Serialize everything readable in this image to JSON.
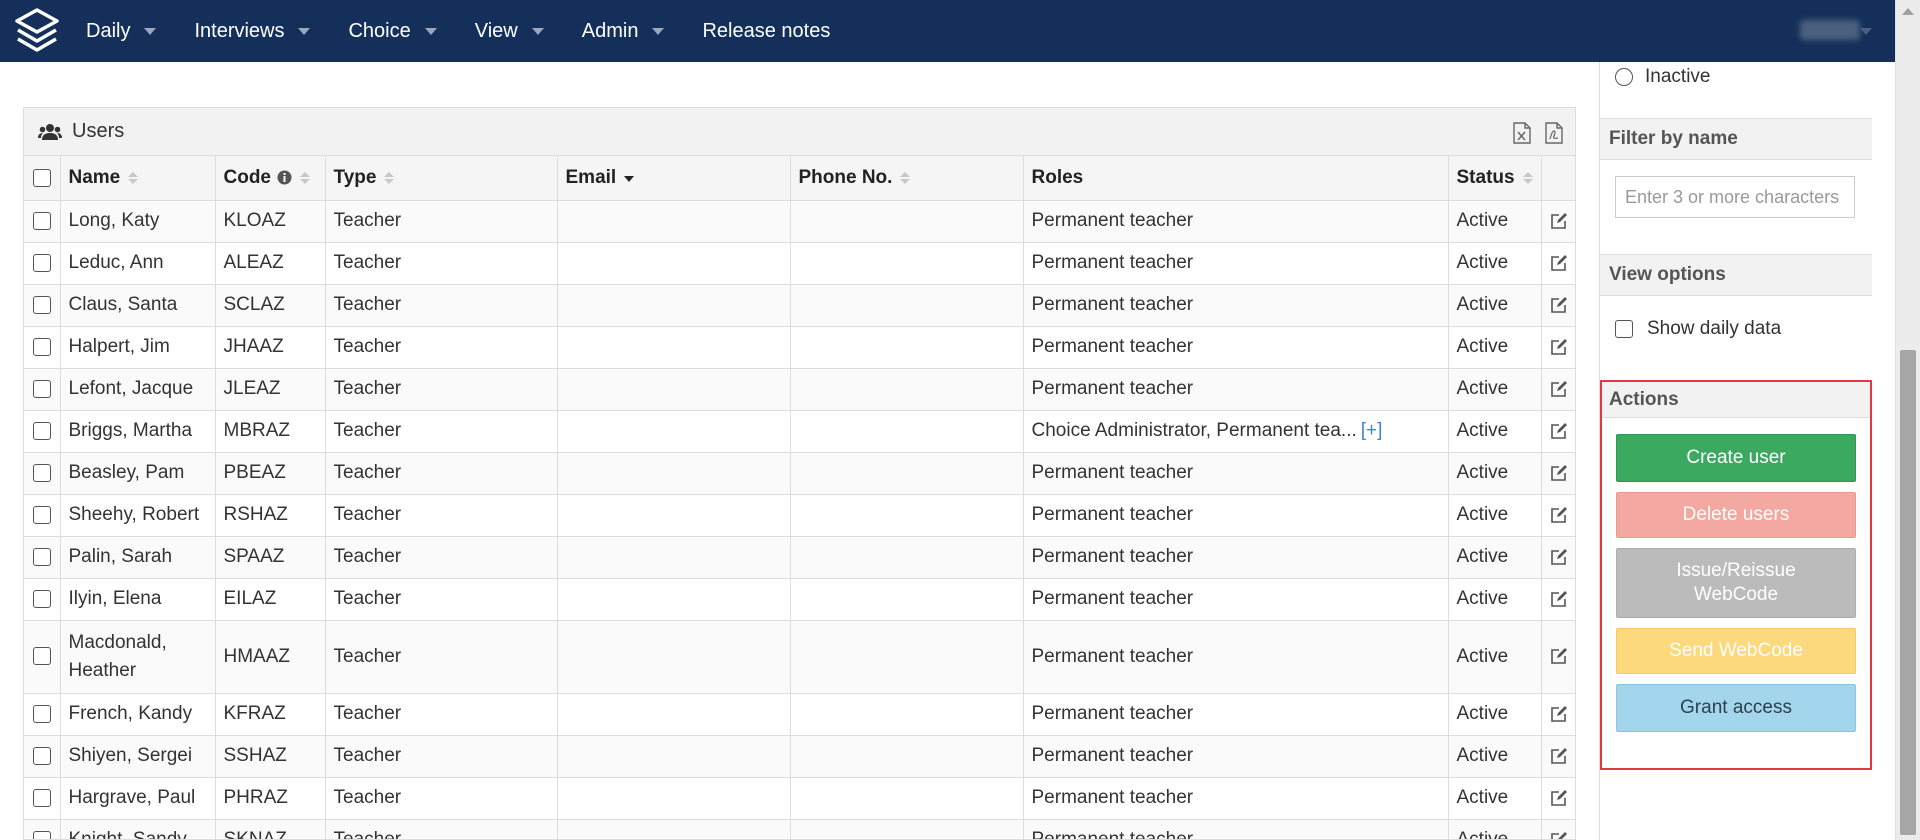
{
  "nav": {
    "items": [
      {
        "label": "Daily",
        "dropdown": true
      },
      {
        "label": "Interviews",
        "dropdown": true
      },
      {
        "label": "Choice",
        "dropdown": true
      },
      {
        "label": "View",
        "dropdown": true
      },
      {
        "label": "Admin",
        "dropdown": true
      },
      {
        "label": "Release notes",
        "dropdown": false
      }
    ]
  },
  "panel": {
    "title": "Users",
    "icon": "users-icon",
    "export_icons": [
      "excel-export-icon",
      "pdf-export-icon"
    ]
  },
  "table": {
    "columns": [
      {
        "key": "select",
        "label": "",
        "width": 36
      },
      {
        "key": "name",
        "label": "Name",
        "sort": "both",
        "width": 155
      },
      {
        "key": "code",
        "label": "Code",
        "sort": "both",
        "info": true,
        "width": 110
      },
      {
        "key": "type",
        "label": "Type",
        "sort": "both",
        "width": 232
      },
      {
        "key": "email",
        "label": "Email",
        "sort": "desc",
        "width": 233
      },
      {
        "key": "phone",
        "label": "Phone No.",
        "sort": "both",
        "width": 233
      },
      {
        "key": "roles",
        "label": "Roles",
        "sort": "none",
        "width": 425
      },
      {
        "key": "status",
        "label": "Status",
        "sort": "both",
        "width": 93
      },
      {
        "key": "edit",
        "label": "",
        "width": 36
      }
    ],
    "rows": [
      {
        "name": "Long, Katy",
        "code": "KLOAZ",
        "type": "Teacher",
        "email": "",
        "phone": "",
        "roles": "Permanent teacher",
        "more": "",
        "status": "Active"
      },
      {
        "name": "Leduc, Ann",
        "code": "ALEAZ",
        "type": "Teacher",
        "email": "",
        "phone": "",
        "roles": "Permanent teacher",
        "more": "",
        "status": "Active"
      },
      {
        "name": "Claus, Santa",
        "code": "SCLAZ",
        "type": "Teacher",
        "email": "",
        "phone": "",
        "roles": "Permanent teacher",
        "more": "",
        "status": "Active"
      },
      {
        "name": "Halpert, Jim",
        "code": "JHAAZ",
        "type": "Teacher",
        "email": "",
        "phone": "",
        "roles": "Permanent teacher",
        "more": "",
        "status": "Active"
      },
      {
        "name": "Lefont, Jacque",
        "code": "JLEAZ",
        "type": "Teacher",
        "email": "",
        "phone": "",
        "roles": "Permanent teacher",
        "more": "",
        "status": "Active"
      },
      {
        "name": "Briggs, Martha",
        "code": "MBRAZ",
        "type": "Teacher",
        "email": "",
        "phone": "",
        "roles": "Choice Administrator, Permanent tea...",
        "more": "[+]",
        "status": "Active"
      },
      {
        "name": "Beasley, Pam",
        "code": "PBEAZ",
        "type": "Teacher",
        "email": "",
        "phone": "",
        "roles": "Permanent teacher",
        "more": "",
        "status": "Active"
      },
      {
        "name": "Sheehy, Robert",
        "code": "RSHAZ",
        "type": "Teacher",
        "email": "",
        "phone": "",
        "roles": "Permanent teacher",
        "more": "",
        "status": "Active"
      },
      {
        "name": "Palin, Sarah",
        "code": "SPAAZ",
        "type": "Teacher",
        "email": "",
        "phone": "",
        "roles": "Permanent teacher",
        "more": "",
        "status": "Active"
      },
      {
        "name": "Ilyin, Elena",
        "code": "EILAZ",
        "type": "Teacher",
        "email": "",
        "phone": "",
        "roles": "Permanent teacher",
        "more": "",
        "status": "Active"
      },
      {
        "name": "Macdonald, Heather",
        "code": "HMAAZ",
        "type": "Teacher",
        "email": "",
        "phone": "",
        "roles": "Permanent teacher",
        "more": "",
        "status": "Active",
        "tall": true
      },
      {
        "name": "French, Kandy",
        "code": "KFRAZ",
        "type": "Teacher",
        "email": "",
        "phone": "",
        "roles": "Permanent teacher",
        "more": "",
        "status": "Active"
      },
      {
        "name": "Shiyen, Sergei",
        "code": "SSHAZ",
        "type": "Teacher",
        "email": "",
        "phone": "",
        "roles": "Permanent teacher",
        "more": "",
        "status": "Active"
      },
      {
        "name": "Hargrave, Paul",
        "code": "PHRAZ",
        "type": "Teacher",
        "email": "",
        "phone": "",
        "roles": "Permanent teacher",
        "more": "",
        "status": "Active"
      },
      {
        "name": "Knight, Sandy",
        "code": "SKNAZ",
        "type": "Teacher",
        "email": "",
        "phone": "",
        "roles": "Permanent teacher",
        "more": "",
        "status": "Active"
      }
    ]
  },
  "sidebar": {
    "status_inactive_label": "Inactive",
    "filter_heading": "Filter by name",
    "filter_placeholder": "Enter 3 or more characters",
    "view_options_heading": "View options",
    "show_daily_label": "Show daily data",
    "actions_heading": "Actions",
    "buttons": {
      "create": "Create user",
      "delete": "Delete users",
      "issue": "Issue/Reissue WebCode",
      "send": "Send WebCode",
      "grant": "Grant access"
    }
  },
  "colors": {
    "navbar": "#14305a",
    "create": "#3ba95f",
    "delete": "#f3a8a1",
    "issue": "#bbbbbb",
    "send": "#fbd97c",
    "grant": "#a3d6ec",
    "highlight": "#e0393e",
    "link": "#3a87d6"
  }
}
